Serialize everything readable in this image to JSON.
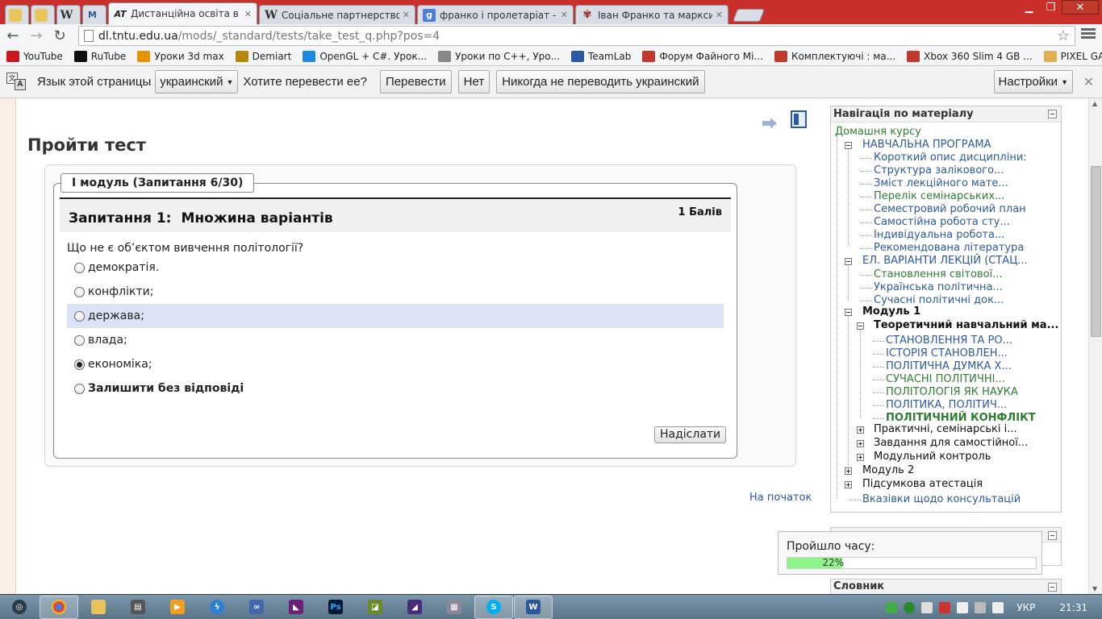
{
  "browser": {
    "tabs": [
      {
        "title": "",
        "pinned": true,
        "icon": "shield-icon"
      },
      {
        "title": "",
        "pinned": true,
        "icon": "shield-icon"
      },
      {
        "title": "",
        "pinned": true,
        "icon": "wikipedia-icon"
      },
      {
        "title": "",
        "pinned": true,
        "icon": "moodle-icon"
      },
      {
        "title": "Дистанційна освіта в ТНТ",
        "active": true,
        "icon": "at-icon"
      },
      {
        "title": "Соціальне партнерство –",
        "icon": "wikipedia-icon"
      },
      {
        "title": "франко і пролетаріат - По",
        "icon": "google-icon"
      },
      {
        "title": "Іван Франко та марксизм",
        "icon": "flower-icon"
      }
    ],
    "url_host": "dl.tntu.edu.ua",
    "url_path": "/mods/_standard/tests/take_test_q.php?pos=4",
    "bookmarks": [
      {
        "label": "YouTube",
        "color": "#cc181e"
      },
      {
        "label": "RuTube",
        "color": "#111111"
      },
      {
        "label": "Уроки 3d max",
        "color": "#e69400"
      },
      {
        "label": "Demiart",
        "color": "#b8860b"
      },
      {
        "label": "OpenGL + C#. Урок...",
        "color": "#1e88e5"
      },
      {
        "label": "Уроки по C++, Уро...",
        "color": "#888888"
      },
      {
        "label": "TeamLab",
        "color": "#2b5aa0"
      },
      {
        "label": "Форум Файного Мі...",
        "color": "#c0392b"
      },
      {
        "label": "Комплектуючі : ма...",
        "color": "#c0392b"
      },
      {
        "label": "Xbox 360 Slim 4 GB ...",
        "color": "#c0392b"
      },
      {
        "label": "PIXEL GAMES",
        "color": "#e0b050"
      }
    ]
  },
  "translate_bar": {
    "label": "Язык этой страницы",
    "language": "украинский",
    "question": "Хотите перевести ее?",
    "translate": "Перевести",
    "no": "Нет",
    "never": "Никогда не переводить украинский",
    "settings": "Настройки"
  },
  "page": {
    "title": "Пройти тест",
    "legend": "I модуль (Запитання 6/30)",
    "question_number": "Запитання 1:",
    "question_type": "Множина варіантів",
    "points": "1 Балів",
    "question_text": "Що не є об’єктом вивчення політології?",
    "options": [
      {
        "label": "демократія.",
        "checked": false
      },
      {
        "label": "конфлікти;",
        "checked": false
      },
      {
        "label": "держава;",
        "checked": false,
        "highlight": true
      },
      {
        "label": "влада;",
        "checked": false
      },
      {
        "label": "економіка;",
        "checked": true
      },
      {
        "label": "Залишити без відповіді",
        "checked": false,
        "bold": true
      }
    ],
    "submit": "Надіслати",
    "to_top": "На початок"
  },
  "nav": {
    "title": "Навігація по матеріалу",
    "items": [
      {
        "label": "Домашня курсу",
        "style": "green"
      },
      {
        "label": "НАВЧАЛЬНА ПРОГРАМА",
        "style": "blue"
      },
      {
        "label": "Короткий опис дисципліни:",
        "style": "blue"
      },
      {
        "label": "Структура залікового...",
        "style": "blue"
      },
      {
        "label": "Зміст лекційного мате...",
        "style": "blue"
      },
      {
        "label": "Перелік семінарських...",
        "style": "green"
      },
      {
        "label": "Семестровий робочий план",
        "style": "blue"
      },
      {
        "label": "Самостійна робота сту...",
        "style": "blue"
      },
      {
        "label": "Індивідуальна робота...",
        "style": "blue"
      },
      {
        "label": "Рекомендована література",
        "style": "blue"
      },
      {
        "label": "ЕЛ. ВАРІАНТИ ЛЕКЦІЙ (СТАЦ...",
        "style": "blue"
      },
      {
        "label": "Становлення світової...",
        "style": "green"
      },
      {
        "label": "Українська політична...",
        "style": "blue"
      },
      {
        "label": "Сучасні політичні док...",
        "style": "blue"
      },
      {
        "label": "Модуль 1",
        "style": "black-bold"
      },
      {
        "label": "Теоретичний навчальний ма...",
        "style": "black-bold"
      },
      {
        "label": "СТАНОВЛЕННЯ ТА РО...",
        "style": "blue"
      },
      {
        "label": "ІСТОРІЯ СТАНОВЛЕН...",
        "style": "blue"
      },
      {
        "label": "ПОЛІТИЧНА ДУМКА Х...",
        "style": "blue"
      },
      {
        "label": "СУЧАСНІ ПОЛІТИЧНІ...",
        "style": "green"
      },
      {
        "label": "ПОЛІТОЛОГІЯ ЯК НАУКА",
        "style": "green"
      },
      {
        "label": "ПОЛІТИКА, ПОЛІТИЧ...",
        "style": "blue"
      },
      {
        "label": "ПОЛІТИЧНИЙ КОНФЛІКТ",
        "style": "green-bold"
      },
      {
        "label": "Практичні, семінарські і...",
        "style": "black"
      },
      {
        "label": "Завдання для самостійної...",
        "style": "black"
      },
      {
        "label": "Модульний контроль",
        "style": "black"
      },
      {
        "label": "Модуль 2",
        "style": "black"
      },
      {
        "label": "Підсумкова атестація",
        "style": "black"
      },
      {
        "label": "Вказівки щодо консультацій",
        "style": "blue"
      }
    ]
  },
  "timer": {
    "label": "Пройшло часу:",
    "percent_text": "22%",
    "percent": 22
  },
  "glossary_title": "Словник",
  "taskbar": {
    "language": "УКР",
    "clock": "21:31"
  }
}
